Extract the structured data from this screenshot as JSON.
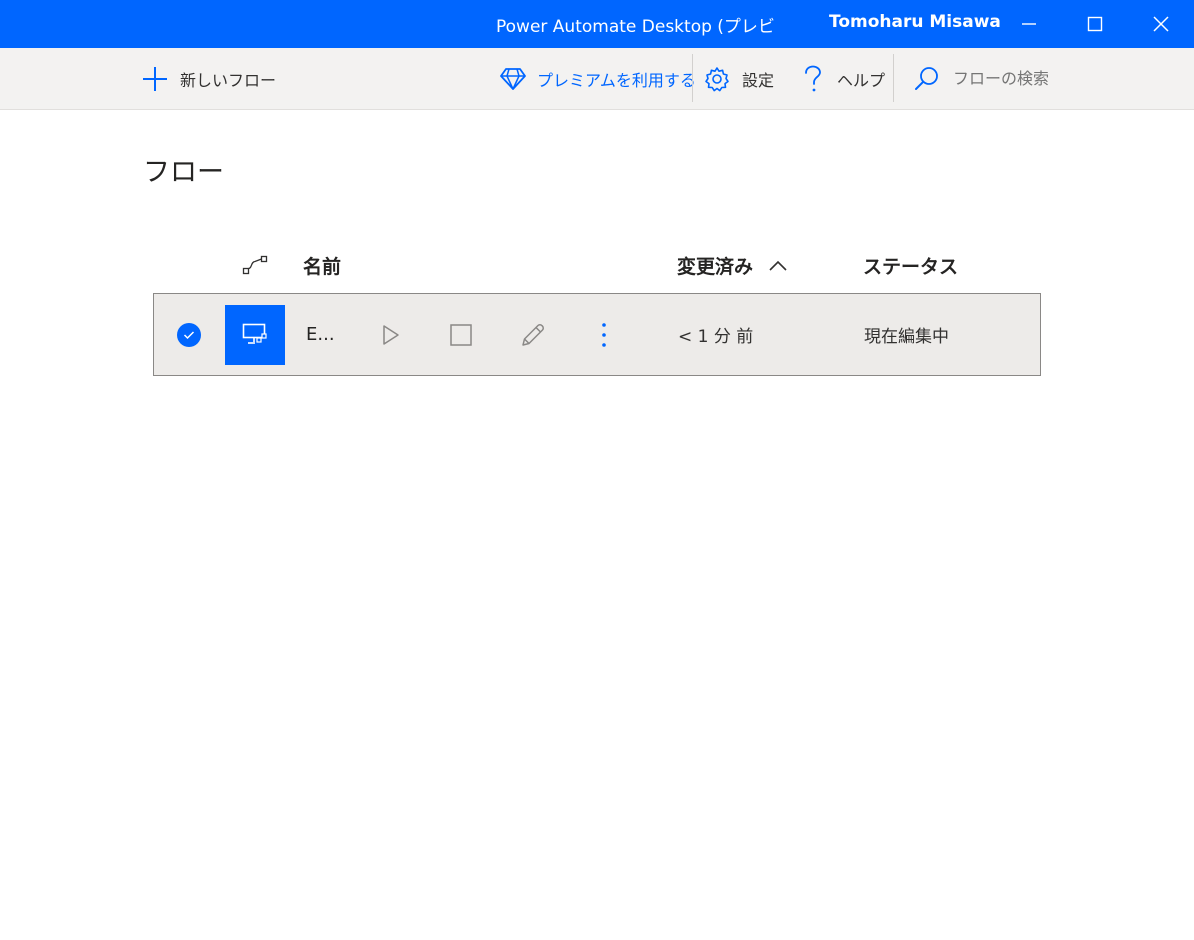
{
  "titlebar": {
    "title": "Power Automate Desktop (プレビ",
    "user": "Tomoharu Misawa"
  },
  "toolbar": {
    "new_flow_label": "新しいフロー",
    "premium_label": "プレミアムを利用する",
    "settings_label": "設定",
    "help_label": "ヘルプ",
    "search_placeholder": "フローの検索"
  },
  "page": {
    "title": "フロー"
  },
  "table": {
    "columns": {
      "name": "名前",
      "modified": "変更済み",
      "status": "ステータス"
    },
    "rows": [
      {
        "name": "E...",
        "modified": "< 1 分 前",
        "status": "現在編集中"
      }
    ]
  },
  "colors": {
    "accent": "#0066ff",
    "toolbar_bg": "#f3f2f1",
    "row_bg": "#edebe9"
  },
  "icons": {
    "titlebar": [
      "minimize-icon",
      "maximize-icon",
      "close-icon"
    ],
    "toolbar": [
      "plus-icon",
      "diamond-icon",
      "gear-icon",
      "question-icon",
      "search-icon"
    ],
    "row": [
      "checkmark-icon",
      "desktop-flow-icon",
      "play-icon",
      "stop-icon",
      "pencil-icon",
      "more-vertical-icon"
    ],
    "header": [
      "flow-connector-icon",
      "chevron-up-icon"
    ]
  }
}
